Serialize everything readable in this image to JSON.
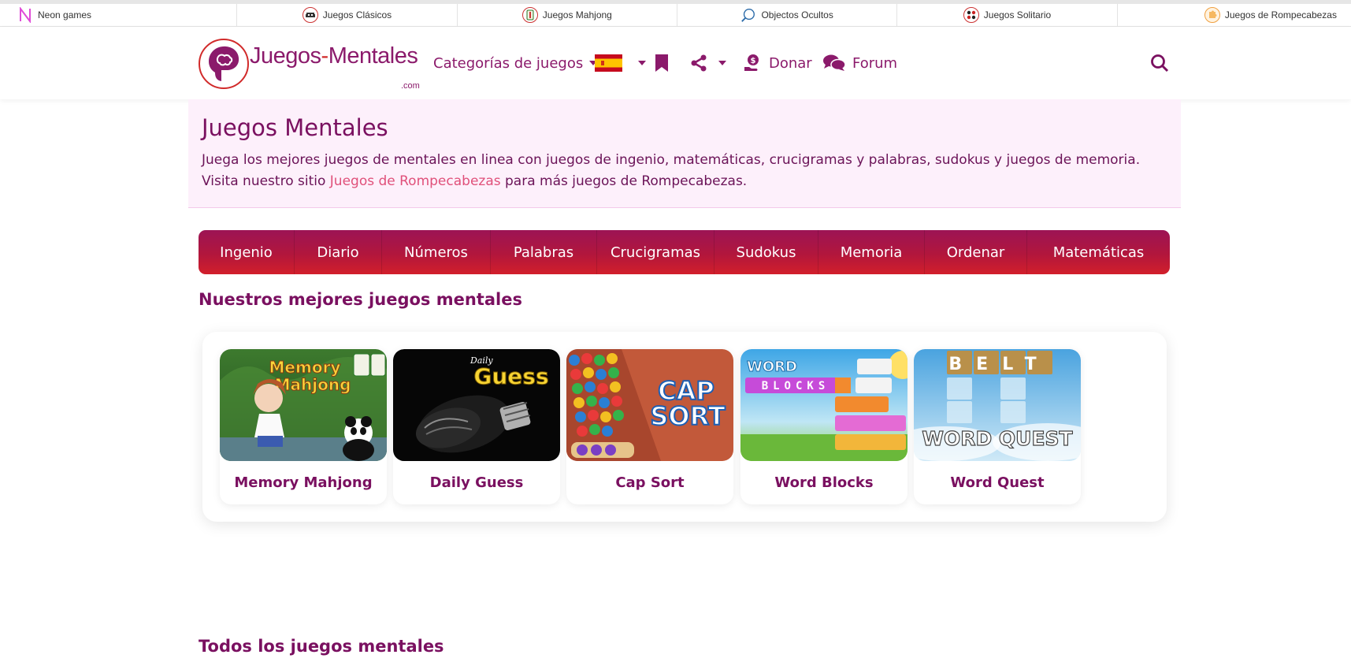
{
  "topbar": {
    "items": [
      {
        "label": "Neon games",
        "icon": "neon-n-icon"
      },
      {
        "label": "Juegos Clásicos",
        "icon": "space-invader-icon"
      },
      {
        "label": "Juegos Mahjong",
        "icon": "mahjong-tile-icon"
      },
      {
        "label": "Objectos Ocultos",
        "icon": "magnifier-icon"
      },
      {
        "label": "Juegos Solitario",
        "icon": "cards-icon"
      },
      {
        "label": "Juegos de Rompecabezas",
        "icon": "puzzle-icon"
      }
    ]
  },
  "header": {
    "logo_text_a": "Juegos",
    "logo_text_dash": "-",
    "logo_text_b": "Mentales",
    "logo_com": ".com",
    "categories_label": "Categorías de juegos",
    "donate_label": "Donar",
    "forum_label": "Forum"
  },
  "intro": {
    "title": "Juegos Mentales",
    "text_before": "Juega los mejores juegos de mentales en linea con juegos de ingenio, matemáticas, crucigramas y palabras, sudokus y juegos de memoria. Visita nuestro sitio ",
    "link_text": "Juegos de Rompecabezas",
    "text_after": " para más juegos de Rompecabezas."
  },
  "categories": [
    "Ingenio",
    "Diario",
    "Números",
    "Palabras",
    "Crucigramas",
    "Sudokus",
    "Memoria",
    "Ordenar",
    "Matemáticas"
  ],
  "sections": {
    "best_title": "Nuestros mejores juegos mentales",
    "all_title": "Todos los juegos mentales"
  },
  "games": [
    {
      "title": "Memory Mahjong",
      "art_text_1": "Memory",
      "art_text_2": "Mahjong"
    },
    {
      "title": "Daily Guess",
      "art_text_1": "Daily",
      "art_text_2": "Guess"
    },
    {
      "title": "Cap Sort",
      "art_text_1": "CAP",
      "art_text_2": "SORT"
    },
    {
      "title": "Word Blocks",
      "art_text_1": "WORD",
      "art_text_2": "BLOCKS"
    },
    {
      "title": "Word Quest",
      "art_text_1": "BELT",
      "art_text_2": "WORD QUEST"
    }
  ],
  "colors": {
    "brand": "#7a1060",
    "accent_link": "#e0507a",
    "nav_gradient_top": "#9c1455",
    "nav_gradient_bottom": "#d21f2b",
    "intro_bg": "#fdf0fb"
  }
}
